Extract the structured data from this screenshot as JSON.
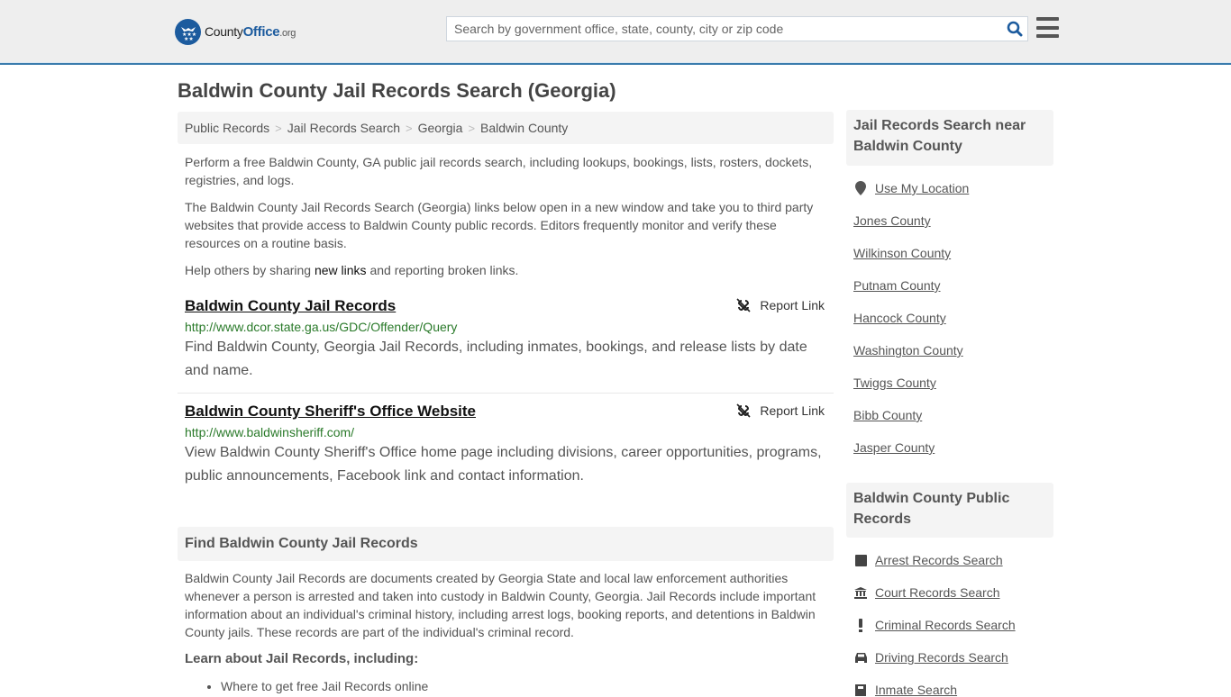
{
  "header": {
    "logo": {
      "brand_main": "County",
      "brand_accent": "Office",
      "brand_tld": ".org"
    },
    "search": {
      "placeholder": "Search by government office, state, county, city or zip code",
      "value": ""
    },
    "colors": {
      "brand_blue": "#1c5b9e",
      "header_bg": "#eeeeee",
      "header_border": "#3a7cad"
    }
  },
  "page": {
    "title": "Baldwin County Jail Records Search (Georgia)",
    "breadcrumb": [
      "Public Records",
      "Jail Records Search",
      "Georgia",
      "Baldwin County"
    ],
    "breadcrumb_sep": ">",
    "intro": {
      "p1": "Perform a free Baldwin County, GA public jail records search, including lookups, bookings, lists, rosters, dockets, registries, and logs.",
      "p2": "The Baldwin County Jail Records Search (Georgia) links below open in a new window and take you to third party websites that provide access to Baldwin County public records. Editors frequently monitor and verify these resources on a routine basis.",
      "p3_before": "Help others by sharing ",
      "p3_link": "new links",
      "p3_after": " and reporting broken links."
    },
    "results": [
      {
        "title": "Baldwin County Jail Records",
        "url": "http://www.dcor.state.ga.us/GDC/Offender/Query",
        "description": "Find Baldwin County, Georgia Jail Records, including inmates, bookings, and release lists by date and name.",
        "report_label": "Report Link"
      },
      {
        "title": "Baldwin County Sheriff's Office Website",
        "url": "http://www.baldwinsheriff.com/",
        "description": "View Baldwin County Sheriff's Office home page including divisions, career opportunities, programs, public announcements, Facebook link and contact information.",
        "report_label": "Report Link"
      }
    ],
    "find_section": {
      "heading": "Find Baldwin County Jail Records",
      "body": "Baldwin County Jail Records are documents created by Georgia State and local law enforcement authorities whenever a person is arrested and taken into custody in Baldwin County, Georgia. Jail Records include important information about an individual's criminal history, including arrest logs, booking reports, and detentions in Baldwin County jails. These records are part of the individual's criminal record.",
      "learn_heading": "Learn about Jail Records, including:",
      "learn_items": [
        "Where to get free Jail Records online"
      ]
    }
  },
  "sidebar": {
    "nearby": {
      "heading": "Jail Records Search near Baldwin County",
      "use_location": "Use My Location",
      "counties": [
        "Jones County",
        "Wilkinson County",
        "Putnam County",
        "Hancock County",
        "Washington County",
        "Twiggs County",
        "Bibb County",
        "Jasper County"
      ]
    },
    "public_records": {
      "heading": "Baldwin County Public Records",
      "items": [
        {
          "label": "Arrest Records Search",
          "icon": "square-icon"
        },
        {
          "label": "Court Records Search",
          "icon": "courthouse-icon"
        },
        {
          "label": "Criminal Records Search",
          "icon": "exclamation-icon"
        },
        {
          "label": "Driving Records Search",
          "icon": "car-icon"
        },
        {
          "label": "Inmate Search",
          "icon": "inmate-icon"
        }
      ]
    }
  }
}
